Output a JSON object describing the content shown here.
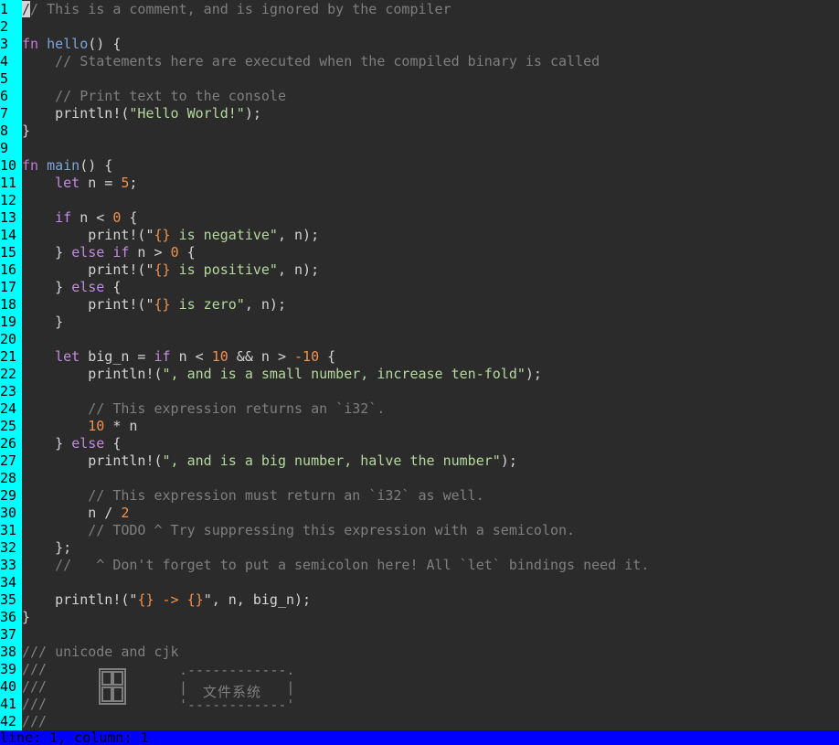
{
  "editor": {
    "gutter_color": "#00ffff",
    "background": "#2b2b2b",
    "lines": [
      {
        "n": "1",
        "tokens": [
          {
            "t": "/",
            "k": "cursor"
          },
          {
            "t": "/ This is a comment, and is ignored by the compiler",
            "k": "c"
          }
        ]
      },
      {
        "n": "2",
        "tokens": []
      },
      {
        "n": "3",
        "tokens": [
          {
            "t": "fn ",
            "k": "kw"
          },
          {
            "t": "hello",
            "k": "fn"
          },
          {
            "t": "() {",
            "k": "pl"
          }
        ]
      },
      {
        "n": "4",
        "tokens": [
          {
            "t": "    ",
            "k": "pl"
          },
          {
            "t": "// Statements here are executed when the compiled binary is called",
            "k": "c"
          }
        ]
      },
      {
        "n": "5",
        "tokens": []
      },
      {
        "n": "6",
        "tokens": [
          {
            "t": "    ",
            "k": "pl"
          },
          {
            "t": "// Print text to the console",
            "k": "c"
          }
        ]
      },
      {
        "n": "7",
        "tokens": [
          {
            "t": "    println!(",
            "k": "pl"
          },
          {
            "t": "\"Hello World!\"",
            "k": "str"
          },
          {
            "t": ");",
            "k": "pl"
          }
        ]
      },
      {
        "n": "8",
        "tokens": [
          {
            "t": "}",
            "k": "pl"
          }
        ]
      },
      {
        "n": "9",
        "tokens": []
      },
      {
        "n": "10",
        "tokens": [
          {
            "t": "fn ",
            "k": "kw"
          },
          {
            "t": "main",
            "k": "fn"
          },
          {
            "t": "() {",
            "k": "pl"
          }
        ]
      },
      {
        "n": "11",
        "tokens": [
          {
            "t": "    ",
            "k": "pl"
          },
          {
            "t": "let",
            "k": "kw2"
          },
          {
            "t": " n = ",
            "k": "pl"
          },
          {
            "t": "5",
            "k": "num"
          },
          {
            "t": ";",
            "k": "pl"
          }
        ]
      },
      {
        "n": "12",
        "tokens": []
      },
      {
        "n": "13",
        "tokens": [
          {
            "t": "    ",
            "k": "pl"
          },
          {
            "t": "if",
            "k": "kw2"
          },
          {
            "t": " n < ",
            "k": "pl"
          },
          {
            "t": "0",
            "k": "num"
          },
          {
            "t": " {",
            "k": "pl"
          }
        ]
      },
      {
        "n": "14",
        "tokens": [
          {
            "t": "        print!(\"",
            "k": "pl"
          },
          {
            "t": "{}",
            "k": "fmt"
          },
          {
            "t": " is negative\"",
            "k": "str"
          },
          {
            "t": ", n);",
            "k": "pl"
          }
        ]
      },
      {
        "n": "15",
        "tokens": [
          {
            "t": "    } ",
            "k": "pl"
          },
          {
            "t": "else if",
            "k": "kw2"
          },
          {
            "t": " n > ",
            "k": "pl"
          },
          {
            "t": "0",
            "k": "num"
          },
          {
            "t": " {",
            "k": "pl"
          }
        ]
      },
      {
        "n": "16",
        "tokens": [
          {
            "t": "        print!(\"",
            "k": "pl"
          },
          {
            "t": "{}",
            "k": "fmt"
          },
          {
            "t": " is positive\"",
            "k": "str"
          },
          {
            "t": ", n);",
            "k": "pl"
          }
        ]
      },
      {
        "n": "17",
        "tokens": [
          {
            "t": "    } ",
            "k": "pl"
          },
          {
            "t": "else",
            "k": "kw2"
          },
          {
            "t": " {",
            "k": "pl"
          }
        ]
      },
      {
        "n": "18",
        "tokens": [
          {
            "t": "        print!(\"",
            "k": "pl"
          },
          {
            "t": "{}",
            "k": "fmt"
          },
          {
            "t": " is zero\"",
            "k": "str"
          },
          {
            "t": ", n);",
            "k": "pl"
          }
        ]
      },
      {
        "n": "19",
        "tokens": [
          {
            "t": "    }",
            "k": "pl"
          }
        ]
      },
      {
        "n": "20",
        "tokens": []
      },
      {
        "n": "21",
        "tokens": [
          {
            "t": "    ",
            "k": "pl"
          },
          {
            "t": "let",
            "k": "kw2"
          },
          {
            "t": " big_n = ",
            "k": "pl"
          },
          {
            "t": "if",
            "k": "kw2"
          },
          {
            "t": " n < ",
            "k": "pl"
          },
          {
            "t": "10",
            "k": "num"
          },
          {
            "t": " && n > ",
            "k": "pl"
          },
          {
            "t": "-10",
            "k": "num"
          },
          {
            "t": " {",
            "k": "pl"
          }
        ]
      },
      {
        "n": "22",
        "tokens": [
          {
            "t": "        println!(",
            "k": "pl"
          },
          {
            "t": "\", and is a small number, increase ten-fold\"",
            "k": "str"
          },
          {
            "t": ");",
            "k": "pl"
          }
        ]
      },
      {
        "n": "23",
        "tokens": []
      },
      {
        "n": "24",
        "tokens": [
          {
            "t": "        ",
            "k": "pl"
          },
          {
            "t": "// This expression returns an `i32`.",
            "k": "c"
          }
        ]
      },
      {
        "n": "25",
        "tokens": [
          {
            "t": "        ",
            "k": "pl"
          },
          {
            "t": "10",
            "k": "num"
          },
          {
            "t": " * n",
            "k": "pl"
          }
        ]
      },
      {
        "n": "26",
        "tokens": [
          {
            "t": "    } ",
            "k": "pl"
          },
          {
            "t": "else",
            "k": "kw2"
          },
          {
            "t": " {",
            "k": "pl"
          }
        ]
      },
      {
        "n": "27",
        "tokens": [
          {
            "t": "        println!(",
            "k": "pl"
          },
          {
            "t": "\", and is a big number, halve the number\"",
            "k": "str"
          },
          {
            "t": ");",
            "k": "pl"
          }
        ]
      },
      {
        "n": "28",
        "tokens": []
      },
      {
        "n": "29",
        "tokens": [
          {
            "t": "        ",
            "k": "pl"
          },
          {
            "t": "// This expression must return an `i32` as well.",
            "k": "c"
          }
        ]
      },
      {
        "n": "30",
        "tokens": [
          {
            "t": "        n / ",
            "k": "pl"
          },
          {
            "t": "2",
            "k": "num"
          }
        ]
      },
      {
        "n": "31",
        "tokens": [
          {
            "t": "        ",
            "k": "pl"
          },
          {
            "t": "// TODO ^ Try suppressing this expression with a semicolon.",
            "k": "c"
          }
        ]
      },
      {
        "n": "32",
        "tokens": [
          {
            "t": "    };",
            "k": "pl"
          }
        ]
      },
      {
        "n": "33",
        "tokens": [
          {
            "t": "    ",
            "k": "pl"
          },
          {
            "t": "//   ^ Don't forget to put a semicolon here! All `let` bindings need it.",
            "k": "c"
          }
        ]
      },
      {
        "n": "34",
        "tokens": []
      },
      {
        "n": "35",
        "tokens": [
          {
            "t": "    println!(\"",
            "k": "pl"
          },
          {
            "t": "{} -> {}",
            "k": "fmt"
          },
          {
            "t": "\", n, big_n);",
            "k": "pl"
          }
        ]
      },
      {
        "n": "36",
        "tokens": [
          {
            "t": "}",
            "k": "pl"
          }
        ]
      },
      {
        "n": "37",
        "tokens": []
      },
      {
        "n": "38",
        "tokens": [
          {
            "t": "/// unicode and cjk",
            "k": "c"
          }
        ]
      },
      {
        "n": "39",
        "tokens": [
          {
            "t": "///",
            "k": "c"
          }
        ]
      },
      {
        "n": "40",
        "tokens": [
          {
            "t": "///",
            "k": "c"
          }
        ]
      },
      {
        "n": "41",
        "tokens": [
          {
            "t": "///",
            "k": "c"
          }
        ]
      },
      {
        "n": "42",
        "tokens": [
          {
            "t": "///",
            "k": "c"
          }
        ]
      }
    ],
    "cjk_frame_top": ".------------.",
    "cjk_frame_mid": "|            |",
    "cjk_frame_bot": "'------------'",
    "cjk_label": "文件系统",
    "box_glyph": "grid-box-icon"
  },
  "statusbar": {
    "text": "line: 1, column: 1",
    "color": "#0000ff"
  }
}
